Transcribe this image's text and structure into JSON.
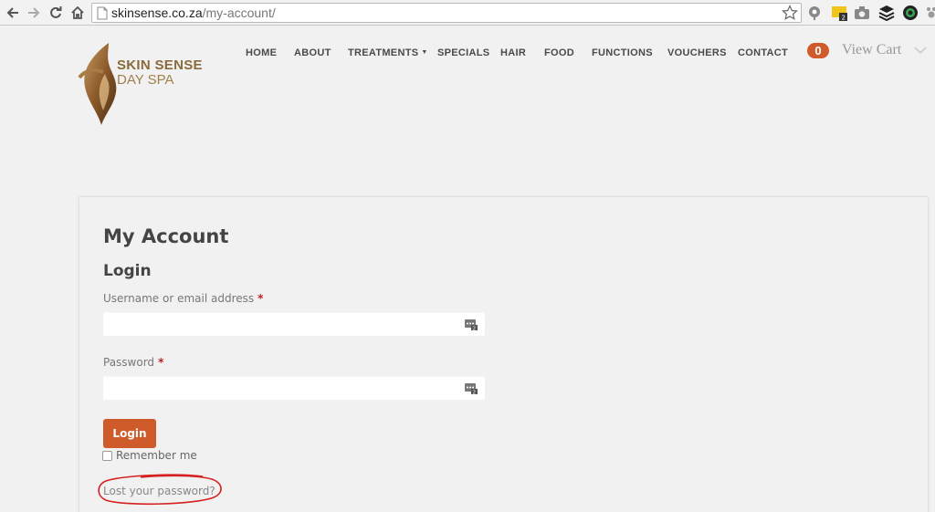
{
  "browser": {
    "url_host": "skinsense.co.za",
    "url_path": "/my-account/"
  },
  "logo": {
    "line1": "SKIN SENSE",
    "line2": "DAY SPA"
  },
  "nav": {
    "items": [
      {
        "label": "HOME"
      },
      {
        "label": "ABOUT"
      },
      {
        "label": "TREATMENTS"
      },
      {
        "label": "SPECIALS"
      },
      {
        "label": "HAIR"
      },
      {
        "label": "FOOD"
      },
      {
        "label": "FUNCTIONS"
      },
      {
        "label": "VOUCHERS"
      },
      {
        "label": "CONTACT"
      }
    ],
    "dropdown_icon": "caret-down-icon"
  },
  "cart": {
    "count": "0",
    "label": "View Cart"
  },
  "account": {
    "title": "My Account",
    "login_heading": "Login",
    "username_label": "Username or email address",
    "password_label": "Password",
    "required_marker": "*",
    "username_value": "",
    "password_value": "",
    "login_button": "Login",
    "remember_label": "Remember me",
    "remember_checked": false,
    "lost_password": "Lost your password?"
  },
  "colors": {
    "accent": "#cf5b2a",
    "brand": "#8a6a3c",
    "annotation": "#d62020"
  }
}
